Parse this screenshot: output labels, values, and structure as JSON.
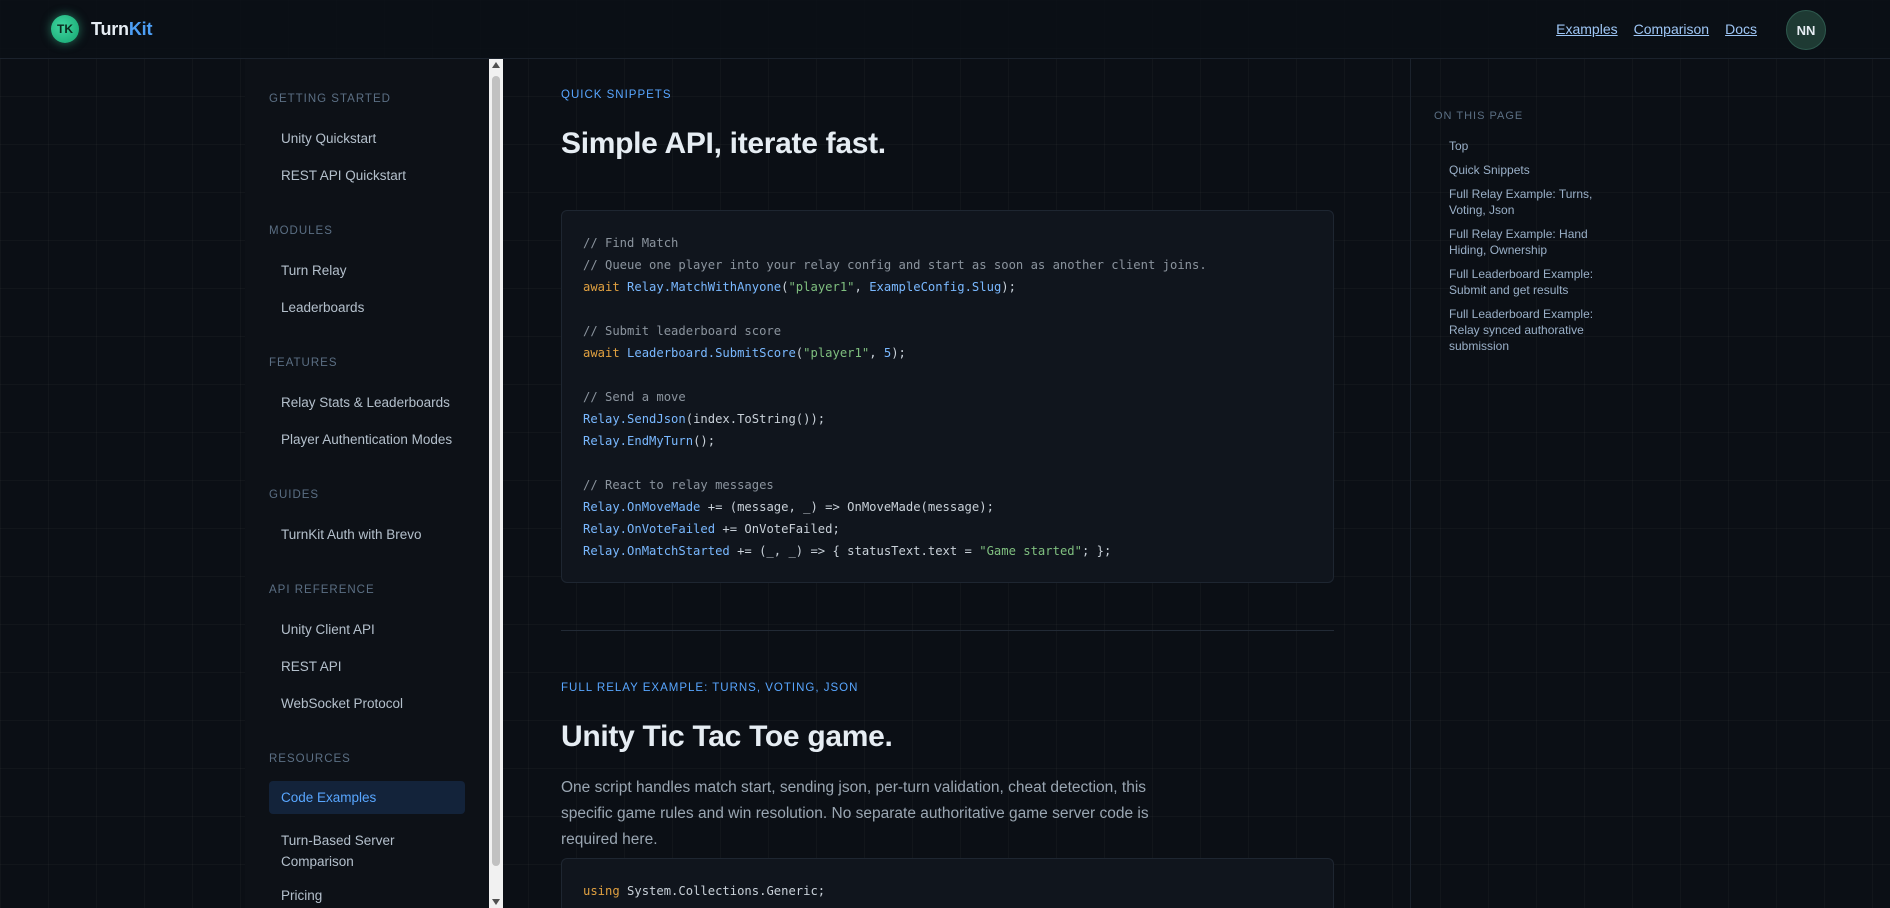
{
  "header": {
    "brand_prefix": "Turn",
    "brand_suffix": "Kit",
    "logo_letters": "TK",
    "nav": [
      "Examples",
      "Comparison",
      "Docs"
    ],
    "avatar": "NN"
  },
  "sidebar": {
    "sections": [
      {
        "title": "GETTING STARTED",
        "items": [
          "Unity Quickstart",
          "REST API Quickstart"
        ]
      },
      {
        "title": "MODULES",
        "items": [
          "Turn Relay",
          "Leaderboards"
        ]
      },
      {
        "title": "FEATURES",
        "items": [
          "Relay Stats & Leaderboards",
          "Player Authentication Modes"
        ]
      },
      {
        "title": "GUIDES",
        "items": [
          "TurnKit Auth with Brevo"
        ]
      },
      {
        "title": "API REFERENCE",
        "items": [
          "Unity Client API",
          "REST API",
          "WebSocket Protocol"
        ]
      },
      {
        "title": "RESOURCES",
        "items": [
          "Code Examples",
          "Turn-Based Server Comparison",
          "Pricing"
        ]
      }
    ],
    "active_item": "Code Examples"
  },
  "main": {
    "section1": {
      "eyebrow": "QUICK SNIPPETS",
      "title": "Simple API, iterate fast.",
      "code": [
        [
          [
            "c-com",
            "// Find Match"
          ]
        ],
        [
          [
            "c-com",
            "// Queue one player into your relay config and start as soon as another client joins."
          ]
        ],
        [
          [
            "c-kw",
            "await "
          ],
          [
            "c-fn",
            "Relay.MatchWithAnyone"
          ],
          [
            "",
            "("
          ],
          [
            "c-str",
            "\"player1\""
          ],
          [
            "",
            ", "
          ],
          [
            "c-fn",
            "ExampleConfig.Slug"
          ],
          [
            "",
            ");"
          ]
        ],
        [],
        [
          [
            "c-com",
            "// Submit leaderboard score"
          ]
        ],
        [
          [
            "c-kw",
            "await "
          ],
          [
            "c-fn",
            "Leaderboard.SubmitScore"
          ],
          [
            "",
            "("
          ],
          [
            "c-str",
            "\"player1\""
          ],
          [
            "",
            ", "
          ],
          [
            "c-num",
            "5"
          ],
          [
            "",
            ");"
          ]
        ],
        [],
        [
          [
            "c-com",
            "// Send a move"
          ]
        ],
        [
          [
            "c-fn",
            "Relay.SendJson"
          ],
          [
            "",
            "(index.ToString());"
          ]
        ],
        [
          [
            "c-fn",
            "Relay.EndMyTurn"
          ],
          [
            "",
            "();"
          ]
        ],
        [],
        [
          [
            "c-com",
            "// React to relay messages"
          ]
        ],
        [
          [
            "c-fn",
            "Relay.OnMoveMade"
          ],
          [
            "",
            " += (message, _) => OnMoveMade(message);"
          ]
        ],
        [
          [
            "c-fn",
            "Relay.OnVoteFailed"
          ],
          [
            "",
            " += OnVoteFailed;"
          ]
        ],
        [
          [
            "c-fn",
            "Relay.OnMatchStarted"
          ],
          [
            "",
            " += (_, _) => { statusText.text = "
          ],
          [
            "c-str",
            "\"Game started\""
          ],
          [
            "",
            "; };"
          ]
        ]
      ]
    },
    "section2": {
      "eyebrow": "FULL RELAY EXAMPLE: TURNS, VOTING, JSON",
      "title": "Unity Tic Tac Toe game.",
      "description": "One script handles match start, sending json, per-turn validation, cheat detection, this specific game rules and win resolution. No separate authoritative game server code is required here.",
      "code": [
        [
          [
            "c-kw",
            "using "
          ],
          [
            "",
            "System.Collections.Generic;"
          ]
        ]
      ]
    }
  },
  "toc": {
    "title": "ON THIS PAGE",
    "items": [
      "Top",
      "Quick Snippets",
      "Full Relay Example: Turns, Voting, Json",
      "Full Relay Example: Hand Hiding, Ownership",
      "Full Leaderboard Example: Submit and get results",
      "Full Leaderboard Example: Relay synced authorative submission"
    ]
  }
}
